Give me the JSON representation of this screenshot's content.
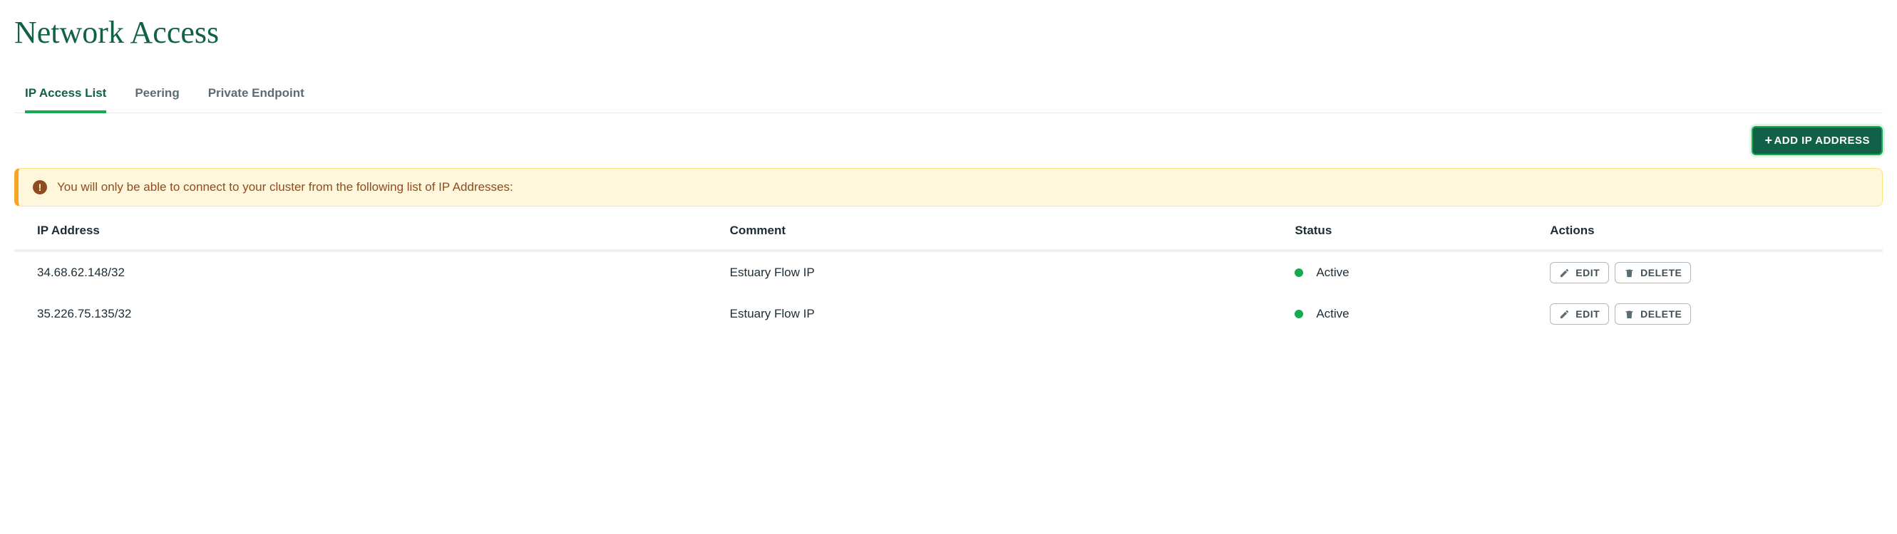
{
  "header": {
    "title": "Network Access"
  },
  "tabs": [
    {
      "label": "IP Access List",
      "active": true
    },
    {
      "label": "Peering",
      "active": false
    },
    {
      "label": "Private Endpoint",
      "active": false
    }
  ],
  "toolbar": {
    "add_button_label": "ADD IP ADDRESS"
  },
  "alert": {
    "message": "You will only be able to connect to your cluster from the following list of IP Addresses:"
  },
  "table": {
    "columns": {
      "ip": "IP Address",
      "comment": "Comment",
      "status": "Status",
      "actions": "Actions"
    },
    "action_labels": {
      "edit": "EDIT",
      "delete": "DELETE"
    },
    "rows": [
      {
        "ip": "34.68.62.148/32",
        "comment": "Estuary Flow IP",
        "status": "Active",
        "status_color": "#13aa52"
      },
      {
        "ip": "35.226.75.135/32",
        "comment": "Estuary Flow IP",
        "status": "Active",
        "status_color": "#13aa52"
      }
    ]
  }
}
